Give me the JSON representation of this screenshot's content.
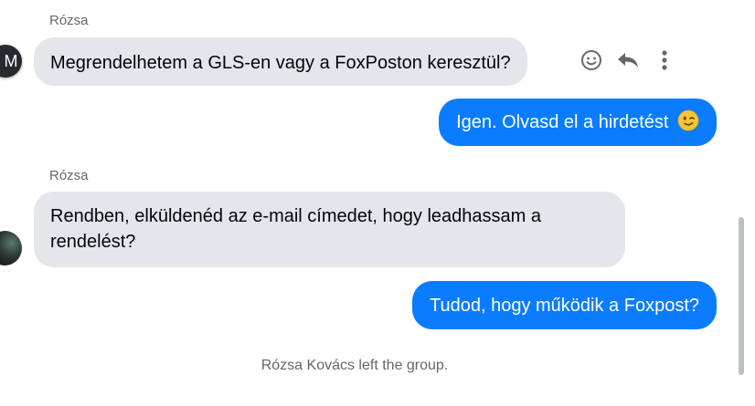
{
  "messages": [
    {
      "sender": "Rózsa",
      "direction": "incoming",
      "avatar_initial": "M",
      "text": "Megrendelhetem a GLS-en vagy a FoxPoston keresztül?"
    },
    {
      "direction": "outgoing",
      "text": "Igen. Olvasd el a hirdetést",
      "emoji": "winking-face-emoji"
    },
    {
      "sender": "Rózsa",
      "direction": "incoming",
      "text": "Rendben, elküldenéd az e-mail címedet, hogy leadhassam a rendelést?"
    },
    {
      "direction": "outgoing",
      "text": "Tudod, hogy működik a Foxpost?"
    }
  ],
  "system_message": "Rózsa Kovács left the group.",
  "message_actions": [
    "react-icon",
    "reply-icon",
    "more-options-icon"
  ],
  "colors": {
    "incoming_bubble": "#e4e6eb",
    "outgoing_bubble": "#0a7cff",
    "meta_text": "#65676b"
  }
}
